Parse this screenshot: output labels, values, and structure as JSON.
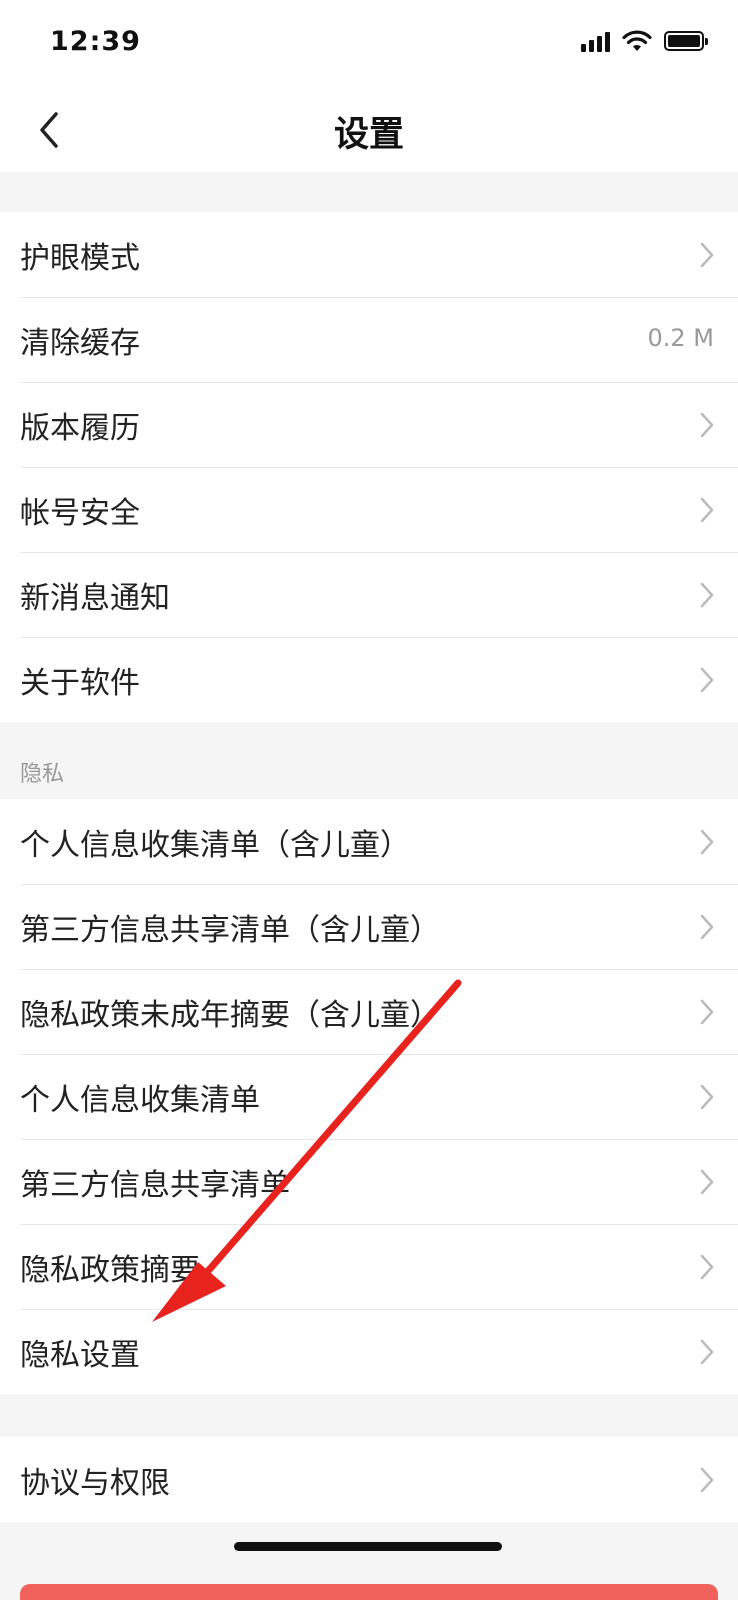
{
  "status_bar": {
    "time": "12:39"
  },
  "nav": {
    "title": "设置",
    "back_icon": "chevron-left-icon"
  },
  "general_group": {
    "items": [
      {
        "label": "护眼模式",
        "value": ""
      },
      {
        "label": "清除缓存",
        "value": "0.2 M"
      },
      {
        "label": "版本履历",
        "value": ""
      },
      {
        "label": "帐号安全",
        "value": ""
      },
      {
        "label": "新消息通知",
        "value": ""
      },
      {
        "label": "关于软件",
        "value": ""
      }
    ]
  },
  "privacy_group": {
    "header": "隐私",
    "items": [
      {
        "label": "个人信息收集清单（含儿童）"
      },
      {
        "label": "第三方信息共享清单（含儿童）"
      },
      {
        "label": "隐私政策未成年摘要（含儿童）"
      },
      {
        "label": "个人信息收集清单"
      },
      {
        "label": "第三方信息共享清单"
      },
      {
        "label": "隐私政策摘要"
      },
      {
        "label": "隐私设置"
      }
    ]
  },
  "agreement_group": {
    "items": [
      {
        "label": "协议与权限"
      }
    ]
  },
  "colors": {
    "accent_arrow": "#e8231d",
    "bottom_button": "#f0625b"
  }
}
